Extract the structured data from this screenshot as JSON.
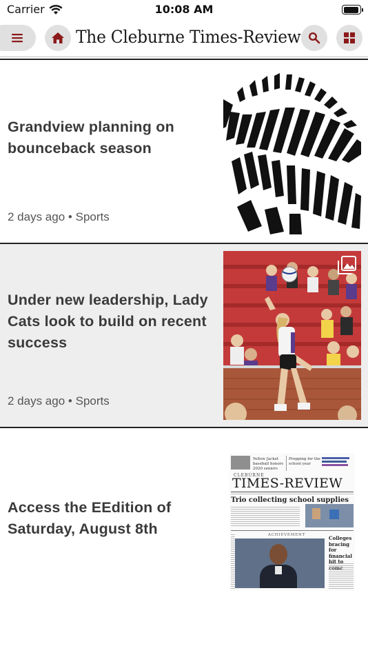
{
  "status_bar": {
    "carrier": "Carrier",
    "time": "10:08 AM",
    "battery_level": 0.95
  },
  "header": {
    "title": "The Cleburne Times-Review",
    "menu_icon": "hamburger-menu-icon",
    "home_icon": "home-icon",
    "search_icon": "search-icon",
    "sections_icon": "grid-icon",
    "accent_color": "#8b1a1a",
    "button_bg": "#e0e0e0"
  },
  "articles": [
    {
      "headline": "Grandview planning on bounceback season",
      "age": "2 days ago",
      "separator": "•",
      "category": "Sports",
      "thumbnail": "zebra-stripes-logo"
    },
    {
      "headline": "Under new leadership, Lady Cats look to build on recent success",
      "age": "2 days ago",
      "separator": "•",
      "category": "Sports",
      "thumbnail": "volleyball-player-photo",
      "gallery_icon": "photo-gallery-icon"
    },
    {
      "headline": "Access the EEdition of Saturday, August  8th",
      "thumbnail": "eedition-front-page"
    }
  ],
  "eedition_page": {
    "masthead_small": "CLEBURNE",
    "masthead": "TIMES-REVIEW",
    "teaser_left": "Yellow Jacket baseball honors 2020 seniors",
    "teaser_right": "Prepping for the school year",
    "lead_headline": "Trio collecting school supplies",
    "section_label": "ACHIEVEMENT",
    "side_headline": "Colleges bracing for financial hit to come"
  }
}
